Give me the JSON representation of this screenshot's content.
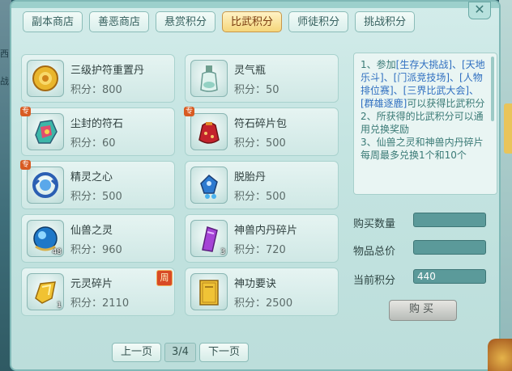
{
  "tabs": [
    {
      "label": "副本商店"
    },
    {
      "label": "善恶商店"
    },
    {
      "label": "悬赏积分"
    },
    {
      "label": "比武积分"
    },
    {
      "label": "师徒积分"
    },
    {
      "label": "挑战积分"
    }
  ],
  "active_tab": "比武积分",
  "price_label": "积分：",
  "items": [
    {
      "name": "三级护符重置丹",
      "price": "800",
      "icon": "gold-amulet-icon",
      "qty": "",
      "tag": ""
    },
    {
      "name": "灵气瓶",
      "price": "50",
      "icon": "spirit-bottle-icon",
      "qty": "",
      "tag": ""
    },
    {
      "name": "尘封的符石",
      "price": "60",
      "icon": "rune-stone-icon",
      "qty": "",
      "tag": "专"
    },
    {
      "name": "符石碎片包",
      "price": "500",
      "icon": "rune-fragment-bag-icon",
      "qty": "",
      "tag": "专"
    },
    {
      "name": "精灵之心",
      "price": "500",
      "icon": "spirit-heart-icon",
      "qty": "",
      "tag": "专"
    },
    {
      "name": "脱胎丹",
      "price": "500",
      "icon": "rebirth-pill-icon",
      "qty": "",
      "tag": ""
    },
    {
      "name": "仙兽之灵",
      "price": "960",
      "icon": "beast-spirit-orb-icon",
      "qty": "48",
      "tag": ""
    },
    {
      "name": "神兽内丹碎片",
      "price": "720",
      "icon": "beast-core-fragment-icon",
      "qty": "3",
      "tag": ""
    },
    {
      "name": "元灵碎片",
      "price": "2110",
      "icon": "yuanling-fragment-icon",
      "qty": "1",
      "tag": "",
      "badge": "周"
    },
    {
      "name": "神功要诀",
      "price": "2500",
      "icon": "skill-book-icon",
      "qty": "",
      "tag": ""
    }
  ],
  "pager": {
    "prev": "上一页",
    "page": "3/4",
    "next": "下一页"
  },
  "description": {
    "line1_a": "1、参加",
    "line1_links": "[生存大挑战]、[天地乐斗]、[门派竞技场]、[人物排位赛]、[三界比武大会]、[群雄逐鹿]",
    "line1_b": "可以获得比武积分",
    "line2": "2、所获得的比武积分可以通用兑换奖励",
    "line3": "3、仙兽之灵和神兽内丹碎片每周最多兑换1个和10个"
  },
  "fields": {
    "qty_label": "购买数量",
    "qty_value": "",
    "total_label": "物品总价",
    "total_value": "",
    "current_label": "当前积分",
    "current_value": "440"
  },
  "buy_label": "购买",
  "side_text": {
    "left_1": "西",
    "left_2": "战"
  }
}
